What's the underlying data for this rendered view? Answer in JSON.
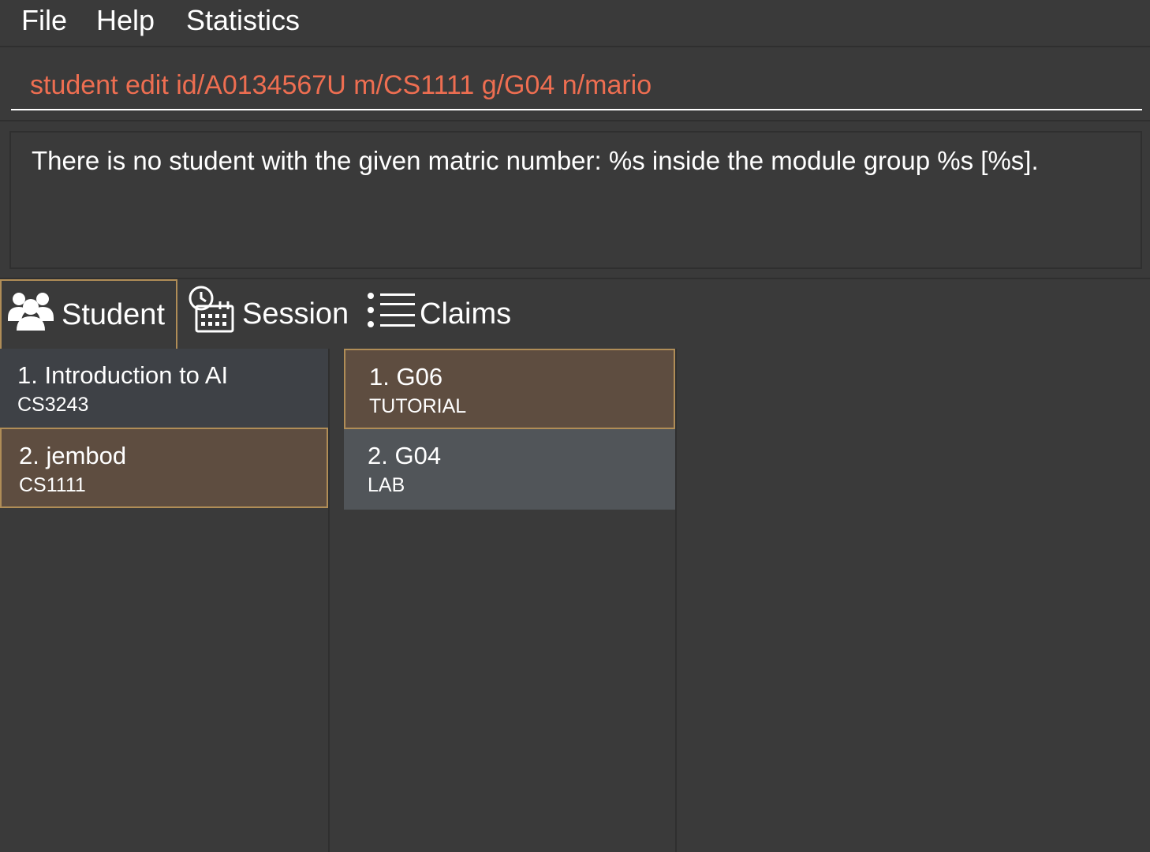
{
  "menu": {
    "file": "File",
    "help": "Help",
    "statistics": "Statistics"
  },
  "command": {
    "value": "student edit id/A0134567U m/CS1111 g/G04 n/mario",
    "text_color": "#ee6e51"
  },
  "result": {
    "message": "There is no student with the given matric number: %s inside the module group %s [%s]."
  },
  "tabs": [
    {
      "label": "Student",
      "icon": "users-icon",
      "active": true
    },
    {
      "label": "Session",
      "icon": "calendar-clock-icon",
      "active": false
    },
    {
      "label": "Claims",
      "icon": "list-icon",
      "active": false
    }
  ],
  "modules": [
    {
      "title": "1.  Introduction to AI",
      "code": "CS3243",
      "selected": false
    },
    {
      "title": "2.  jembod",
      "code": "CS1111",
      "selected": true
    }
  ],
  "groups": [
    {
      "title": "1.  G06",
      "type": "TUTORIAL",
      "selected": true
    },
    {
      "title": "2.  G04",
      "type": "LAB",
      "selected": false
    }
  ],
  "colors": {
    "background": "#3a3a3a",
    "selected_card": "#5e4d40",
    "selected_border": "#b08d57",
    "command_text": "#ee6e51"
  }
}
